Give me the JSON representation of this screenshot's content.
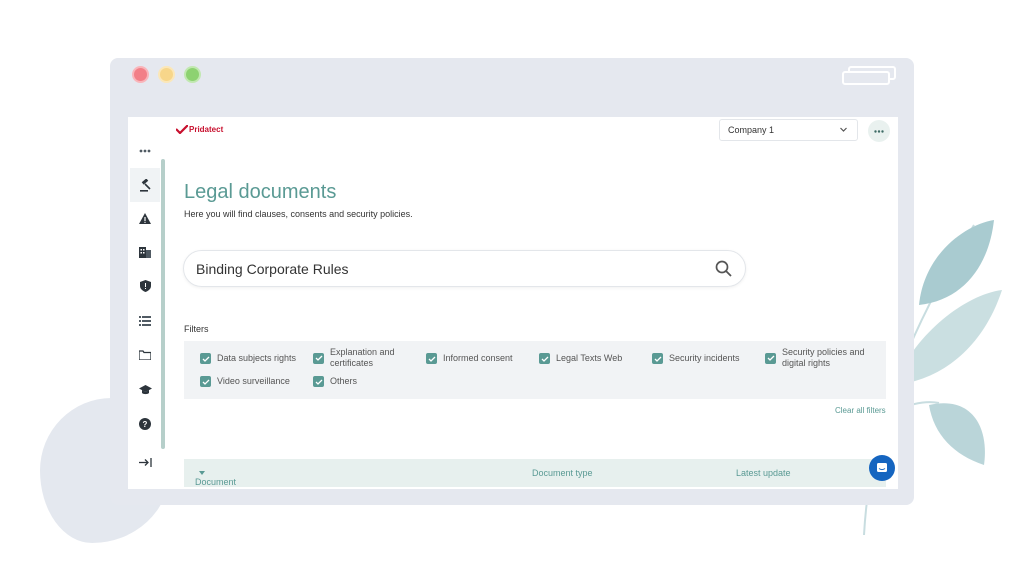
{
  "app": {
    "logo_text": "Pridatect"
  },
  "header": {
    "company_value": "Company 1"
  },
  "sidebar": {
    "items": [
      {
        "icon": "more-horizontal-icon"
      },
      {
        "icon": "gavel-icon",
        "active": true
      },
      {
        "icon": "warning-icon"
      },
      {
        "icon": "building-icon"
      },
      {
        "icon": "shield-icon"
      },
      {
        "icon": "list-icon"
      },
      {
        "icon": "folder-icon"
      },
      {
        "icon": "graduation-cap-icon"
      },
      {
        "icon": "help-icon"
      },
      {
        "icon": "collapse-sidebar-icon"
      }
    ]
  },
  "main": {
    "title": "Legal documents",
    "subtitle": "Here you will find clauses, consents and security policies.",
    "search_value": "Binding Corporate Rules",
    "filters_label": "Filters",
    "filters": [
      {
        "label": "Data subjects rights",
        "checked": true
      },
      {
        "label": "Explanation and certificates",
        "checked": true
      },
      {
        "label": "Informed consent",
        "checked": true
      },
      {
        "label": "Legal Texts Web",
        "checked": true
      },
      {
        "label": "Security incidents",
        "checked": true
      },
      {
        "label": "Security policies and digital rights",
        "checked": true
      },
      {
        "label": "Video surveillance",
        "checked": true
      },
      {
        "label": "Others",
        "checked": true
      }
    ],
    "clear_filters": "Clear all filters",
    "table": {
      "columns": [
        "Document name",
        "Document type",
        "Latest update"
      ]
    }
  },
  "colors": {
    "accent": "#5a9a94",
    "chat": "#1565c0",
    "logo": "#c8102e"
  }
}
